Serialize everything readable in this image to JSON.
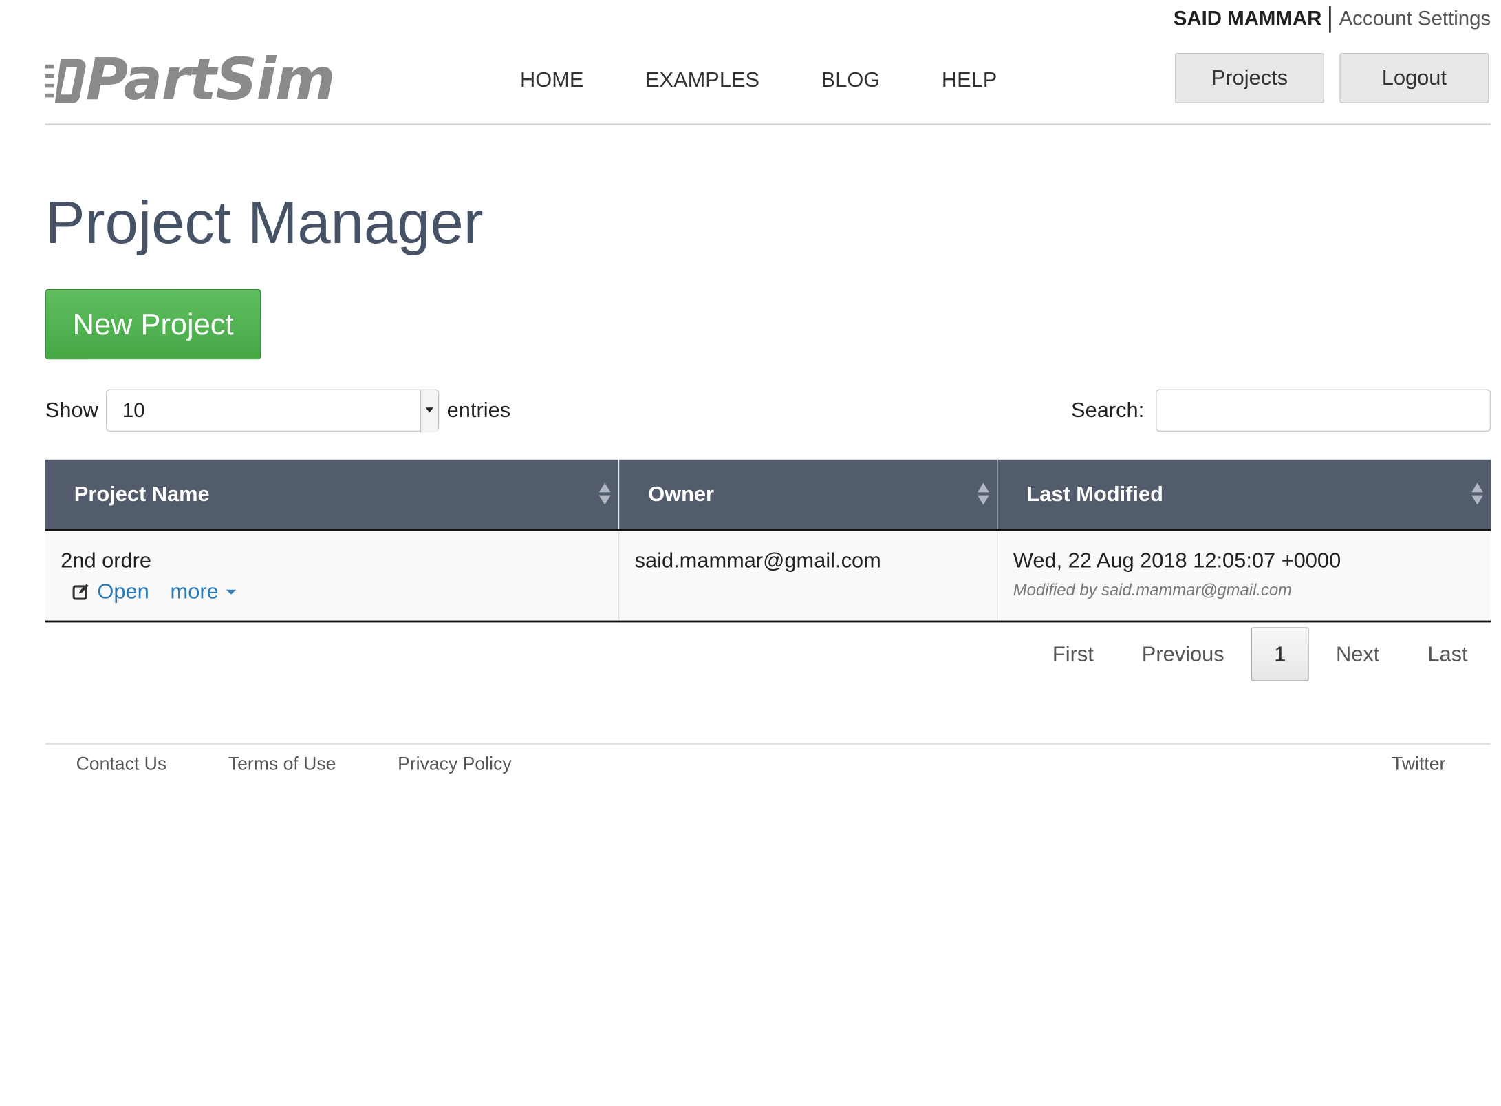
{
  "user": {
    "name": "SAID MAMMAR",
    "account_settings": "Account Settings"
  },
  "logo": {
    "text_bold": "PartSim",
    "text_full": "PartSim"
  },
  "nav": {
    "items": [
      "HOME",
      "EXAMPLES",
      "BLOG",
      "HELP"
    ]
  },
  "header_buttons": {
    "projects": "Projects",
    "logout": "Logout"
  },
  "page": {
    "title": "Project Manager",
    "new_project": "New Project"
  },
  "table_controls": {
    "show_label": "Show",
    "entries_value": "10",
    "entries_label": "entries",
    "search_label": "Search:",
    "search_value": ""
  },
  "table": {
    "columns": [
      "Project Name",
      "Owner",
      "Last Modified"
    ],
    "rows": [
      {
        "name": "2nd ordre",
        "open": "Open",
        "more": "more",
        "owner": "said.mammar@gmail.com",
        "modified": "Wed, 22 Aug 2018 12:05:07 +0000",
        "modified_by": "Modified by said.mammar@gmail.com"
      }
    ]
  },
  "pagination": {
    "first": "First",
    "previous": "Previous",
    "current": "1",
    "next": "Next",
    "last": "Last"
  },
  "footer": {
    "links": [
      "Contact Us",
      "Terms of Use",
      "Privacy Policy"
    ],
    "twitter": "Twitter"
  },
  "colors": {
    "accent_green": "#4cae4c",
    "table_header": "#525c6c",
    "link_blue": "#2a7ab8",
    "title": "#465265"
  }
}
